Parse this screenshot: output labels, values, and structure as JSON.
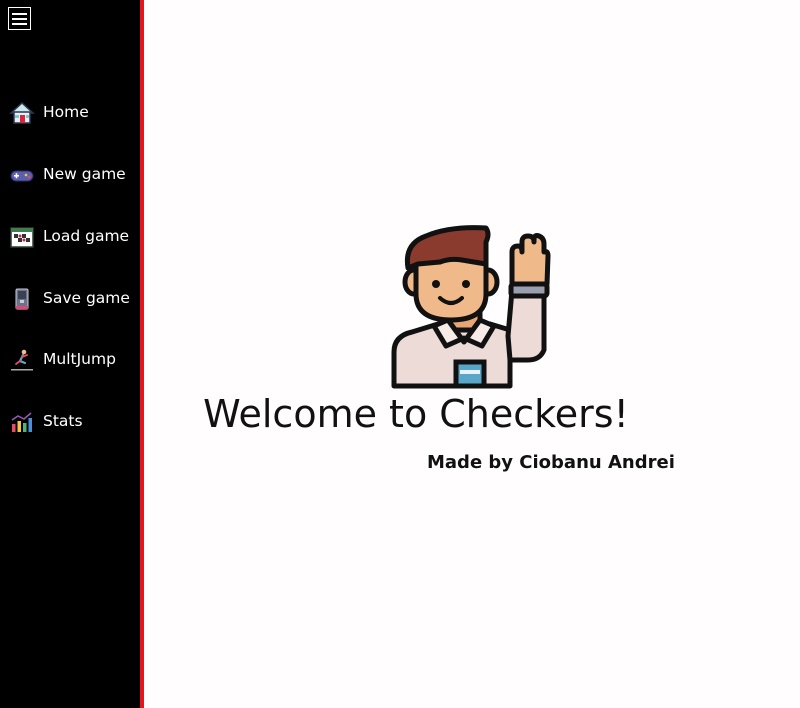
{
  "sidebar": {
    "menu_icon": "hamburger-menu-icon",
    "items": [
      {
        "label": "Home",
        "icon": "house-icon"
      },
      {
        "label": "New game",
        "icon": "gamepad-icon"
      },
      {
        "label": "Load game",
        "icon": "game-board-icon"
      },
      {
        "label": "Save game",
        "icon": "floppy-device-icon"
      },
      {
        "label": "MultJump",
        "icon": "jumping-person-icon"
      },
      {
        "label": "Stats",
        "icon": "bar-chart-icon"
      }
    ],
    "accent_color": "#e3161f",
    "background": "#000000"
  },
  "main": {
    "hero_icon": "waving-man-icon",
    "title": "Welcome to Checkers!",
    "author": "Made by Ciobanu Andrei"
  }
}
